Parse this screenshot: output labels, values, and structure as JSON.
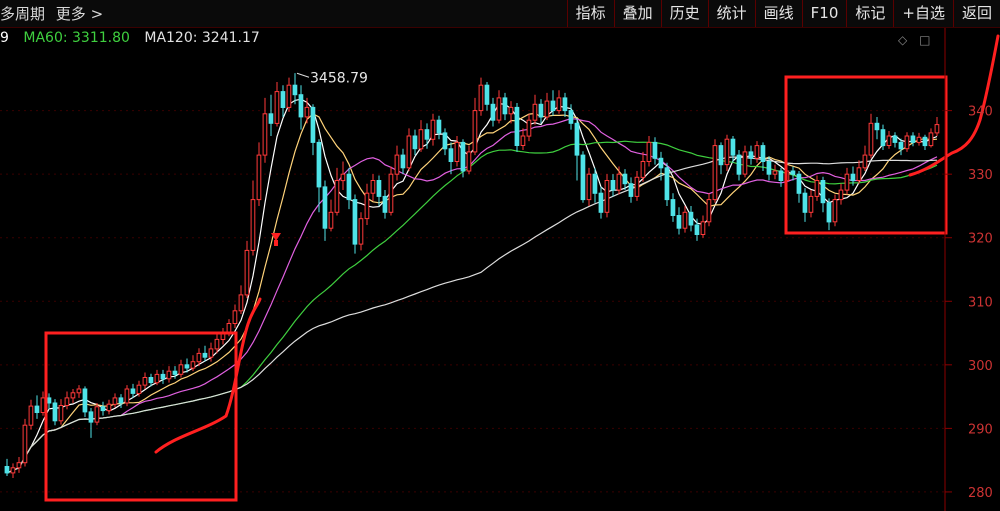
{
  "toolbar": {
    "left_items": [
      "多周期",
      "更多 >"
    ],
    "buttons": [
      "指标",
      "叠加",
      "历史",
      "统计",
      "画线",
      "F10",
      "标记",
      "+自选",
      "返回"
    ]
  },
  "ma_legend": [
    {
      "label": "9",
      "color": "#ffffff"
    },
    {
      "label": "MA60: 3311.80",
      "color": "#3fcf3f"
    },
    {
      "label": "MA120: 3241.17",
      "color": "#e0e0e0"
    }
  ],
  "colors": {
    "up": "#ff3a3a",
    "down": "#4fe3e8",
    "ma5": "#ffffff",
    "ma10": "#ffd37a",
    "ma20": "#e060e0",
    "ma60": "#3fcf3f",
    "ma120": "#dddddd",
    "annotation": "#ff2020",
    "axis": "#8b0000"
  },
  "chart_data": {
    "type": "candlestick",
    "ylim": [
      2770,
      3530
    ],
    "y_ticks": [
      2800,
      2900,
      3000,
      3100,
      3200,
      3300,
      3400
    ],
    "y_tick_labels": [
      "280",
      "290",
      "300",
      "310",
      "320",
      "330",
      "340"
    ],
    "high_marker": {
      "label": "3458.79",
      "value": 3458.79,
      "index": 48
    },
    "candles": [
      [
        2840,
        2830,
        2852,
        2825
      ],
      [
        2830,
        2838,
        2845,
        2822
      ],
      [
        2838,
        2846,
        2855,
        2830
      ],
      [
        2846,
        2905,
        2915,
        2840
      ],
      [
        2905,
        2935,
        2945,
        2898
      ],
      [
        2935,
        2925,
        2952,
        2915
      ],
      [
        2925,
        2948,
        2958,
        2920
      ],
      [
        2948,
        2940,
        2955,
        2930
      ],
      [
        2940,
        2912,
        2946,
        2905
      ],
      [
        2912,
        2936,
        2946,
        2906
      ],
      [
        2936,
        2948,
        2958,
        2930
      ],
      [
        2948,
        2956,
        2962,
        2940
      ],
      [
        2956,
        2962,
        2968,
        2948
      ],
      [
        2962,
        2926,
        2966,
        2918
      ],
      [
        2926,
        2910,
        2932,
        2885
      ],
      [
        2910,
        2934,
        2940,
        2905
      ],
      [
        2934,
        2928,
        2942,
        2920
      ],
      [
        2928,
        2938,
        2945,
        2922
      ],
      [
        2938,
        2948,
        2955,
        2933
      ],
      [
        2948,
        2940,
        2954,
        2932
      ],
      [
        2940,
        2962,
        2968,
        2935
      ],
      [
        2962,
        2955,
        2970,
        2948
      ],
      [
        2955,
        2968,
        2975,
        2950
      ],
      [
        2968,
        2980,
        2988,
        2962
      ],
      [
        2980,
        2972,
        2986,
        2966
      ],
      [
        2972,
        2985,
        2992,
        2968
      ],
      [
        2985,
        2978,
        2992,
        2970
      ],
      [
        2978,
        2990,
        2998,
        2972
      ],
      [
        2990,
        2985,
        2998,
        2978
      ],
      [
        2985,
        3000,
        3008,
        2980
      ],
      [
        3000,
        2995,
        3010,
        2988
      ],
      [
        2995,
        3005,
        3015,
        2990
      ],
      [
        3005,
        3018,
        3026,
        2998
      ],
      [
        3018,
        3012,
        3030,
        3005
      ],
      [
        3012,
        3025,
        3035,
        3005
      ],
      [
        3025,
        3040,
        3048,
        3018
      ],
      [
        3040,
        3050,
        3058,
        3032
      ],
      [
        3050,
        3065,
        3072,
        3045
      ],
      [
        3065,
        3085,
        3095,
        3058
      ],
      [
        3085,
        3110,
        3125,
        3080
      ],
      [
        3110,
        3180,
        3195,
        3105
      ],
      [
        3180,
        3260,
        3290,
        3172
      ],
      [
        3260,
        3330,
        3350,
        3250
      ],
      [
        3330,
        3395,
        3420,
        3318
      ],
      [
        3395,
        3380,
        3425,
        3360
      ],
      [
        3380,
        3430,
        3445,
        3375
      ],
      [
        3430,
        3405,
        3440,
        3390
      ],
      [
        3405,
        3440,
        3452,
        3398
      ],
      [
        3440,
        3425,
        3459,
        3410
      ],
      [
        3425,
        3390,
        3440,
        3370
      ],
      [
        3390,
        3405,
        3420,
        3380
      ],
      [
        3405,
        3350,
        3410,
        3330
      ],
      [
        3350,
        3280,
        3355,
        3240
      ],
      [
        3280,
        3215,
        3290,
        3195
      ],
      [
        3215,
        3240,
        3260,
        3210
      ],
      [
        3240,
        3290,
        3310,
        3235
      ],
      [
        3290,
        3300,
        3320,
        3275
      ],
      [
        3300,
        3260,
        3310,
        3245
      ],
      [
        3260,
        3190,
        3268,
        3175
      ],
      [
        3190,
        3230,
        3240,
        3180
      ],
      [
        3230,
        3270,
        3285,
        3220
      ],
      [
        3270,
        3290,
        3300,
        3258
      ],
      [
        3290,
        3265,
        3298,
        3250
      ],
      [
        3265,
        3240,
        3275,
        3230
      ],
      [
        3240,
        3300,
        3312,
        3235
      ],
      [
        3300,
        3330,
        3345,
        3290
      ],
      [
        3330,
        3310,
        3340,
        3300
      ],
      [
        3310,
        3360,
        3372,
        3305
      ],
      [
        3360,
        3340,
        3370,
        3330
      ],
      [
        3340,
        3370,
        3385,
        3335
      ],
      [
        3370,
        3355,
        3380,
        3340
      ],
      [
        3355,
        3385,
        3395,
        3345
      ],
      [
        3385,
        3365,
        3392,
        3355
      ],
      [
        3365,
        3340,
        3372,
        3330
      ],
      [
        3340,
        3320,
        3350,
        3300
      ],
      [
        3320,
        3350,
        3360,
        3312
      ],
      [
        3350,
        3305,
        3355,
        3295
      ],
      [
        3305,
        3335,
        3345,
        3300
      ],
      [
        3335,
        3400,
        3420,
        3330
      ],
      [
        3400,
        3440,
        3452,
        3392
      ],
      [
        3440,
        3410,
        3445,
        3400
      ],
      [
        3410,
        3385,
        3420,
        3375
      ],
      [
        3385,
        3420,
        3432,
        3380
      ],
      [
        3420,
        3395,
        3428,
        3385
      ],
      [
        3395,
        3405,
        3415,
        3380
      ],
      [
        3405,
        3345,
        3412,
        3335
      ],
      [
        3345,
        3360,
        3372,
        3338
      ],
      [
        3360,
        3385,
        3395,
        3352
      ],
      [
        3385,
        3410,
        3425,
        3378
      ],
      [
        3410,
        3390,
        3418,
        3380
      ],
      [
        3390,
        3415,
        3428,
        3385
      ],
      [
        3415,
        3400,
        3432,
        3392
      ],
      [
        3400,
        3420,
        3432,
        3395
      ],
      [
        3420,
        3400,
        3428,
        3390
      ],
      [
        3400,
        3380,
        3410,
        3370
      ],
      [
        3380,
        3330,
        3388,
        3290
      ],
      [
        3330,
        3260,
        3336,
        3255
      ],
      [
        3260,
        3300,
        3310,
        3250
      ],
      [
        3300,
        3270,
        3310,
        3255
      ],
      [
        3270,
        3240,
        3280,
        3230
      ],
      [
        3240,
        3290,
        3300,
        3232
      ],
      [
        3290,
        3275,
        3300,
        3265
      ],
      [
        3275,
        3300,
        3312,
        3268
      ],
      [
        3300,
        3285,
        3308,
        3275
      ],
      [
        3285,
        3265,
        3295,
        3255
      ],
      [
        3265,
        3295,
        3305,
        3258
      ],
      [
        3295,
        3320,
        3335,
        3288
      ],
      [
        3320,
        3350,
        3360,
        3312
      ],
      [
        3350,
        3325,
        3358,
        3315
      ],
      [
        3325,
        3310,
        3335,
        3290
      ],
      [
        3310,
        3260,
        3318,
        3250
      ],
      [
        3260,
        3235,
        3270,
        3225
      ],
      [
        3235,
        3215,
        3248,
        3205
      ],
      [
        3215,
        3240,
        3250,
        3208
      ],
      [
        3240,
        3220,
        3250,
        3210
      ],
      [
        3220,
        3205,
        3230,
        3195
      ],
      [
        3205,
        3225,
        3235,
        3200
      ],
      [
        3225,
        3260,
        3270,
        3218
      ],
      [
        3260,
        3345,
        3355,
        3255
      ],
      [
        3345,
        3315,
        3350,
        3300
      ],
      [
        3315,
        3355,
        3362,
        3305
      ],
      [
        3355,
        3330,
        3360,
        3318
      ],
      [
        3330,
        3300,
        3338,
        3290
      ],
      [
        3300,
        3335,
        3345,
        3295
      ],
      [
        3335,
        3325,
        3345,
        3315
      ],
      [
        3325,
        3345,
        3352,
        3318
      ],
      [
        3345,
        3320,
        3350,
        3305
      ],
      [
        3320,
        3300,
        3328,
        3290
      ],
      [
        3300,
        3305,
        3315,
        3292
      ],
      [
        3305,
        3290,
        3310,
        3280
      ],
      [
        3290,
        3305,
        3316,
        3282
      ],
      [
        3305,
        3300,
        3312,
        3290
      ],
      [
        3300,
        3270,
        3305,
        3255
      ],
      [
        3270,
        3240,
        3278,
        3225
      ],
      [
        3240,
        3265,
        3275,
        3232
      ],
      [
        3265,
        3290,
        3298,
        3258
      ],
      [
        3290,
        3255,
        3296,
        3240
      ],
      [
        3255,
        3225,
        3262,
        3212
      ],
      [
        3225,
        3260,
        3268,
        3218
      ],
      [
        3260,
        3275,
        3285,
        3252
      ],
      [
        3275,
        3300,
        3310,
        3268
      ],
      [
        3300,
        3290,
        3312,
        3282
      ],
      [
        3290,
        3310,
        3322,
        3285
      ],
      [
        3310,
        3330,
        3345,
        3305
      ],
      [
        3330,
        3380,
        3395,
        3325
      ],
      [
        3380,
        3370,
        3390,
        3355
      ],
      [
        3370,
        3345,
        3378,
        3338
      ],
      [
        3345,
        3360,
        3368,
        3340
      ],
      [
        3360,
        3350,
        3366,
        3342
      ],
      [
        3350,
        3340,
        3356,
        3330
      ],
      [
        3340,
        3360,
        3366,
        3335
      ],
      [
        3360,
        3350,
        3366,
        3344
      ],
      [
        3350,
        3358,
        3365,
        3345
      ],
      [
        3358,
        3345,
        3362,
        3338
      ],
      [
        3345,
        3365,
        3372,
        3342
      ],
      [
        3365,
        3378,
        3390,
        3360
      ]
    ]
  }
}
